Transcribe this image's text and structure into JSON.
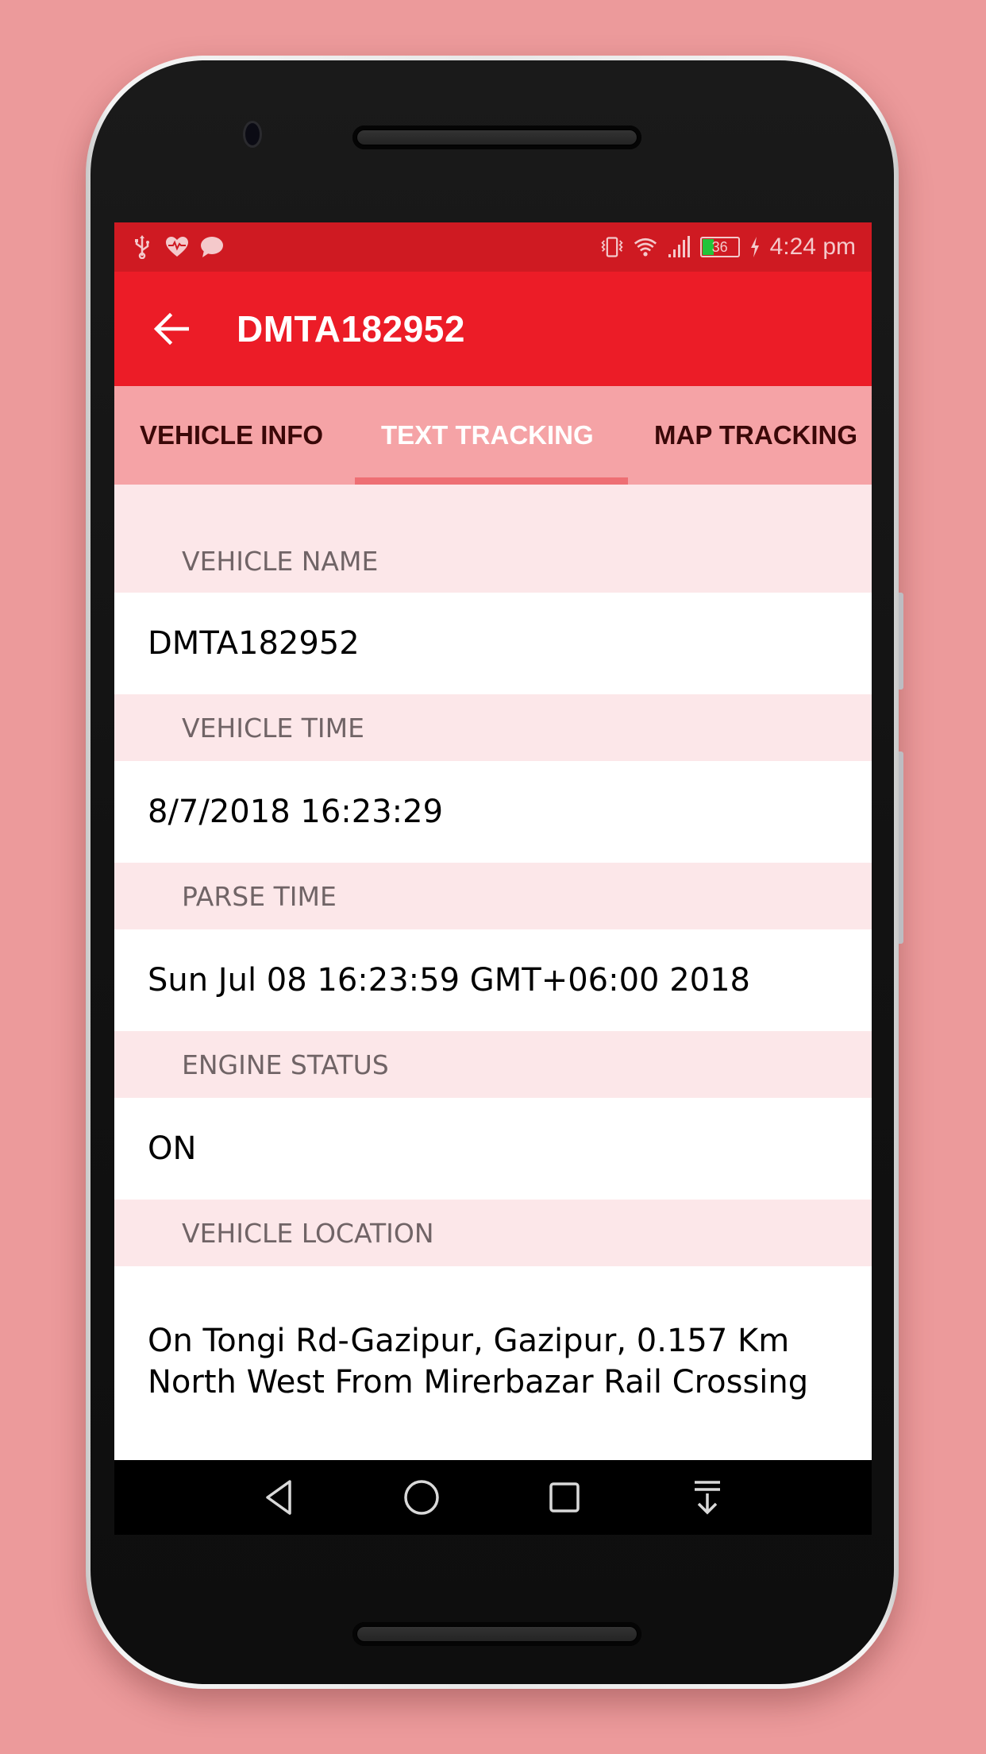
{
  "status_bar": {
    "left_icons": [
      "usb-icon",
      "heart-rate-icon",
      "chat-bubble-icon"
    ],
    "right_icons": [
      "vibrate-icon",
      "wifi-icon",
      "signal-icon",
      "battery-icon",
      "charging-icon"
    ],
    "battery_level": "36",
    "time": "4:24 pm"
  },
  "app_bar": {
    "back_icon": "arrow-left-icon",
    "title": "DMTA182952"
  },
  "tabs": [
    {
      "label": "VEHICLE INFO",
      "active": false
    },
    {
      "label": "TEXT TRACKING",
      "active": true
    },
    {
      "label": "MAP TRACKING",
      "active": false
    }
  ],
  "fields": [
    {
      "label": "VEHICLE NAME",
      "value": "DMTA182952"
    },
    {
      "label": "VEHICLE TIME",
      "value": "8/7/2018 16:23:29"
    },
    {
      "label": "PARSE TIME",
      "value": "Sun Jul 08 16:23:59 GMT+06:00 2018"
    },
    {
      "label": "ENGINE STATUS",
      "value": "ON"
    },
    {
      "label": "VEHICLE LOCATION",
      "value": "On Tongi Rd-Gazipur, Gazipur, 0.157 Km North West From Mirerbazar Rail Crossing"
    }
  ],
  "nav_bar": [
    "back-triangle-icon",
    "home-circle-icon",
    "recents-square-icon",
    "notification-pull-down-icon"
  ],
  "colors": {
    "status_bar": "#cf1a22",
    "app_bar": "#ec1c27",
    "tab_bar": "#f5a3a6",
    "tab_indicator": "#ee6f74",
    "label_background": "#fce7e9",
    "background": "#ec9a9b"
  }
}
